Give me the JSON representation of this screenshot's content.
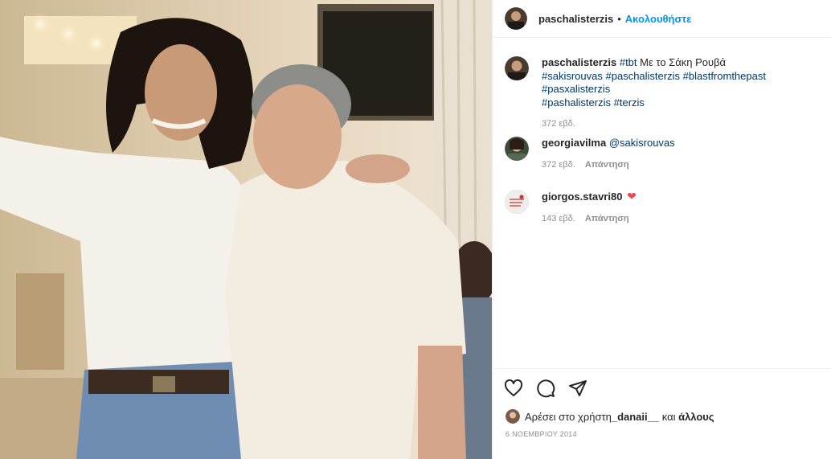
{
  "post": {
    "author": "paschalisterzis",
    "separator": "•",
    "follow_label": "Ακολουθήστε"
  },
  "caption": {
    "user": "paschalisterzis",
    "tag_tbt": "#tbt",
    "text": " Με το Σάκη Ρουβά",
    "tags": [
      "#sakisrouvas",
      "#paschalisterzis",
      "#blastfromthepast",
      "#pasxalisterzis",
      "#pashalisterzis",
      "#terzis"
    ],
    "time": "372 εβδ."
  },
  "comments": [
    {
      "user": "georgiavilma",
      "mention": "@sakisrouvas",
      "time": "372 εβδ.",
      "reply_label": "Απάντηση"
    },
    {
      "user": "giorgos.stavri80",
      "emoji": "❤",
      "time": "143 εβδ.",
      "reply_label": "Απάντηση"
    }
  ],
  "likes": {
    "prefix": "Αρέσει στο χρήστη ",
    "user": "_danaii__",
    "middle": " και ",
    "others": "άλλους"
  },
  "date": "6 ΝΟΕΜΒΡΙΟΥ 2014",
  "icons": [
    "heart-icon",
    "comment-icon",
    "share-icon"
  ],
  "colors": {
    "link": "#0095f6",
    "tag": "#00376b",
    "muted": "#8e8e8e",
    "like_heart": "#ed4956"
  }
}
